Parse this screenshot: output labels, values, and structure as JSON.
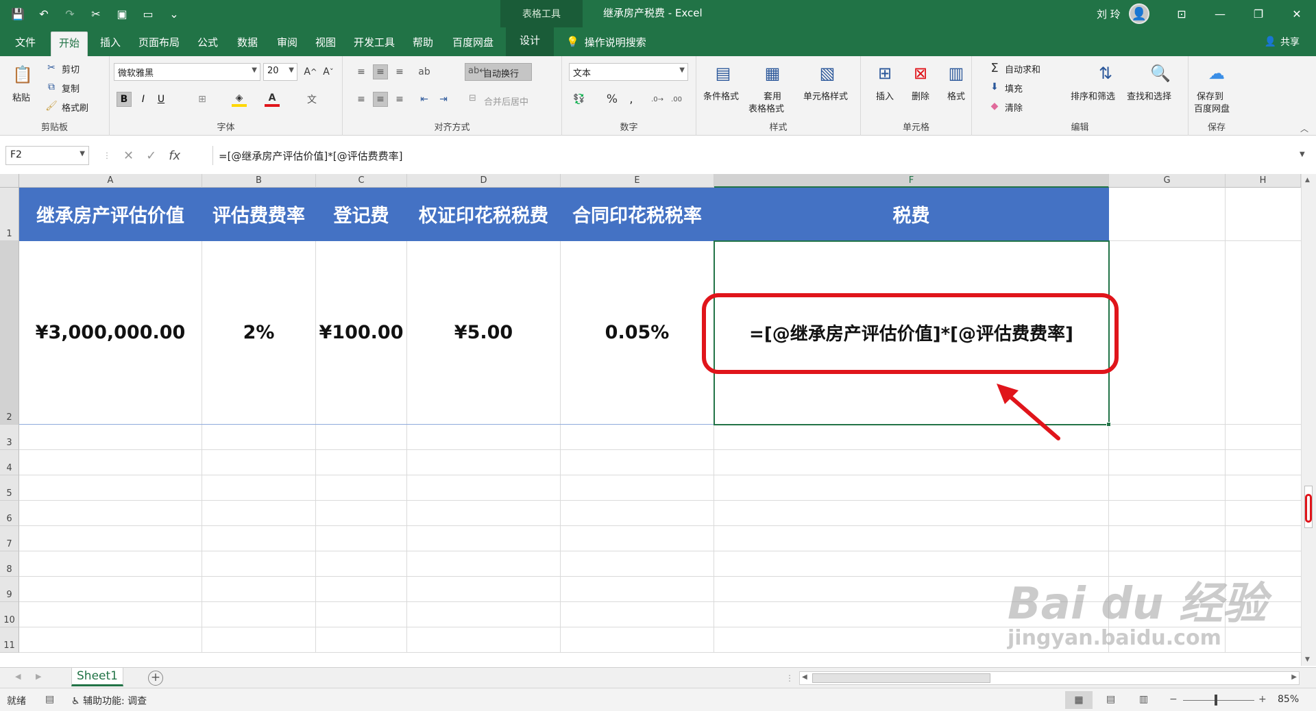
{
  "window": {
    "title": "继承房产税费 - Excel",
    "context_tab_group": "表格工具",
    "user_name": "刘 玲"
  },
  "menu": {
    "tabs": [
      "文件",
      "开始",
      "插入",
      "页面布局",
      "公式",
      "数据",
      "审阅",
      "视图",
      "开发工具",
      "帮助",
      "百度网盘",
      "设计"
    ],
    "active_tab": "开始",
    "tell_me": "操作说明搜索",
    "share": "共享"
  },
  "ribbon": {
    "clipboard": {
      "label": "剪贴板",
      "paste": "粘贴",
      "cut": "剪切",
      "copy": "复制",
      "format_painter": "格式刷"
    },
    "font": {
      "label": "字体",
      "name": "微软雅黑",
      "size": "20",
      "bold": "B",
      "italic": "I",
      "underline": "U"
    },
    "alignment": {
      "label": "对齐方式",
      "wrap": "自动换行",
      "merge": "合并后居中"
    },
    "number": {
      "label": "数字",
      "format": "文本",
      "percent": "%",
      "comma": ","
    },
    "styles": {
      "label": "样式",
      "conditional": "条件格式",
      "table_line1": "套用",
      "table_line2": "表格格式",
      "cell_styles": "单元格样式"
    },
    "cells": {
      "label": "单元格",
      "insert": "插入",
      "delete": "删除",
      "format": "格式"
    },
    "editing": {
      "label": "编辑",
      "autosum": "自动求和",
      "fill": "填充",
      "clear": "清除",
      "sort": "排序和筛选",
      "find": "查找和选择"
    },
    "save": {
      "label": "保存",
      "line1": "保存到",
      "line2": "百度网盘"
    }
  },
  "formula_bar": {
    "name_box": "F2",
    "cancel": "✕",
    "enter": "✓",
    "fx": "fx",
    "formula": "=[@继承房产评估价值]*[@评估费费率]"
  },
  "sheet": {
    "columns": [
      "A",
      "B",
      "C",
      "D",
      "E",
      "F",
      "G",
      "H"
    ],
    "rows": [
      "1",
      "2",
      "3",
      "4",
      "5",
      "6",
      "7",
      "8",
      "9",
      "10",
      "11"
    ],
    "headers": [
      "继承房产评估价值",
      "评估费费率",
      "登记费",
      "权证印花税税费",
      "合同印花税税率",
      "税费"
    ],
    "values": [
      "¥3,000,000.00",
      "2%",
      "¥100.00",
      "¥5.00",
      "0.05%",
      "=[@继承房产评估价值]*[@评估费费率]"
    ],
    "active_cell": "F2"
  },
  "sheet_tabs": {
    "tabs": [
      "Sheet1"
    ],
    "add": "+"
  },
  "status_bar": {
    "ready": "就绪",
    "accessibility": "辅助功能: 调查",
    "zoom": "85%",
    "zoom_minus": "−",
    "zoom_plus": "+"
  },
  "colors": {
    "excel_green": "#217346",
    "table_header": "#4472c4",
    "annotation": "#e0151b"
  },
  "watermark": {
    "brand": "Bai du 经验",
    "url": "jingyan.baidu.com"
  }
}
